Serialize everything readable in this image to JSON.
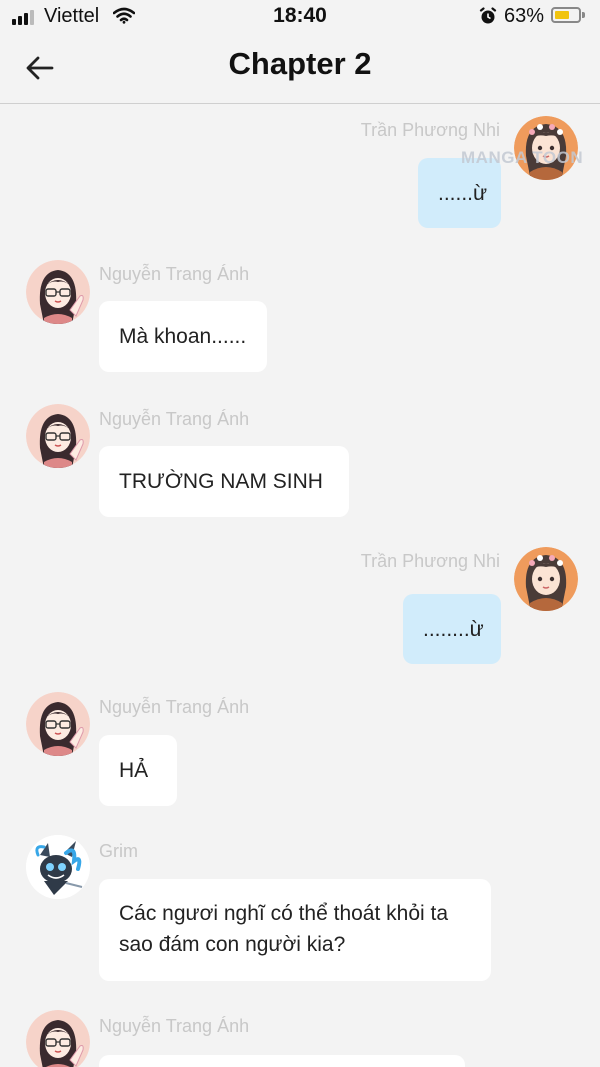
{
  "status_bar": {
    "carrier": "Viettel",
    "time": "18:40",
    "battery_percent": "63%",
    "battery_level": 0.63,
    "icons": [
      "signal-icon",
      "wifi-icon",
      "alarm-icon",
      "battery-icon"
    ]
  },
  "header": {
    "title": "Chapter 2",
    "back_icon": "arrow-left-icon"
  },
  "watermark": "MANGA TOON",
  "colors": {
    "background": "#f3f3f3",
    "incoming_bubble": "#ffffff",
    "outgoing_bubble": "#d1ecfb",
    "sender_name": "#c8c8c8"
  },
  "messages": [
    {
      "sender": "Trần Phương Nhi",
      "text": "......ừ",
      "side": "right"
    },
    {
      "sender": "Nguyễn Trang Ánh",
      "text": "Mà khoan......",
      "side": "left"
    },
    {
      "sender": "Nguyễn Trang Ánh",
      "text": "TRƯỜNG NAM SINH",
      "side": "left"
    },
    {
      "sender": "Trần Phương Nhi",
      "text": "........ừ",
      "side": "right"
    },
    {
      "sender": "Nguyễn Trang Ánh",
      "text": "HẢ",
      "side": "left"
    },
    {
      "sender": "Grim",
      "text_line1": "Các ngươi nghĩ có thể thoát khỏi ta",
      "text_line2": "sao đám con người kia?",
      "side": "left"
    },
    {
      "sender": "Nguyễn Trang Ánh",
      "text": "",
      "side": "left"
    }
  ]
}
